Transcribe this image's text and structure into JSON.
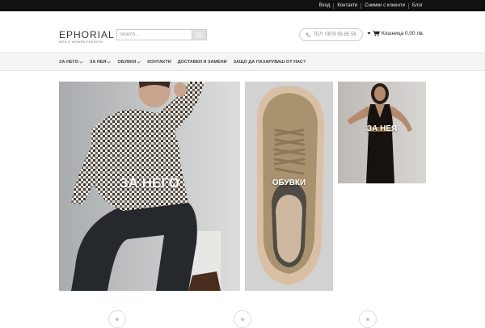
{
  "topbar": {
    "links": [
      "Вход",
      "Контакти",
      "Снимки с клиенти",
      "Блог"
    ]
  },
  "header": {
    "logo_text": "EPHORIAL",
    "logo_tagline": "MEN & WOMEN FASHION",
    "search_placeholder": "Search...",
    "phone": "ТЕЛ: 0878 95 85 58",
    "cart_label": "Кошница 0.00 лв."
  },
  "nav": {
    "items": [
      {
        "label": "ЗА НЕГО",
        "dropdown": true
      },
      {
        "label": "ЗА НЕЯ",
        "dropdown": true
      },
      {
        "label": "ОБУВКИ",
        "dropdown": true
      },
      {
        "label": "КОНТАКТИ",
        "dropdown": false
      },
      {
        "label": "ДОСТАВКИ И ЗАМЕНИ",
        "dropdown": false
      },
      {
        "label": "ЗАЩО ДА ПАЗАРУВАШ ОТ НАС?",
        "dropdown": false
      }
    ]
  },
  "banners": {
    "him_label": "ЗА НЕГО",
    "shoes_label": "ОБУВКИ",
    "her_label": "ЗА НЕЯ"
  },
  "icons": {
    "search": "search-icon",
    "phone": "phone-icon",
    "cart": "cart-icon",
    "star": "star-icon"
  },
  "colors": {
    "topbar_bg": "#111111",
    "nav_bg": "#f5f5f5",
    "text_dark": "#222222"
  }
}
